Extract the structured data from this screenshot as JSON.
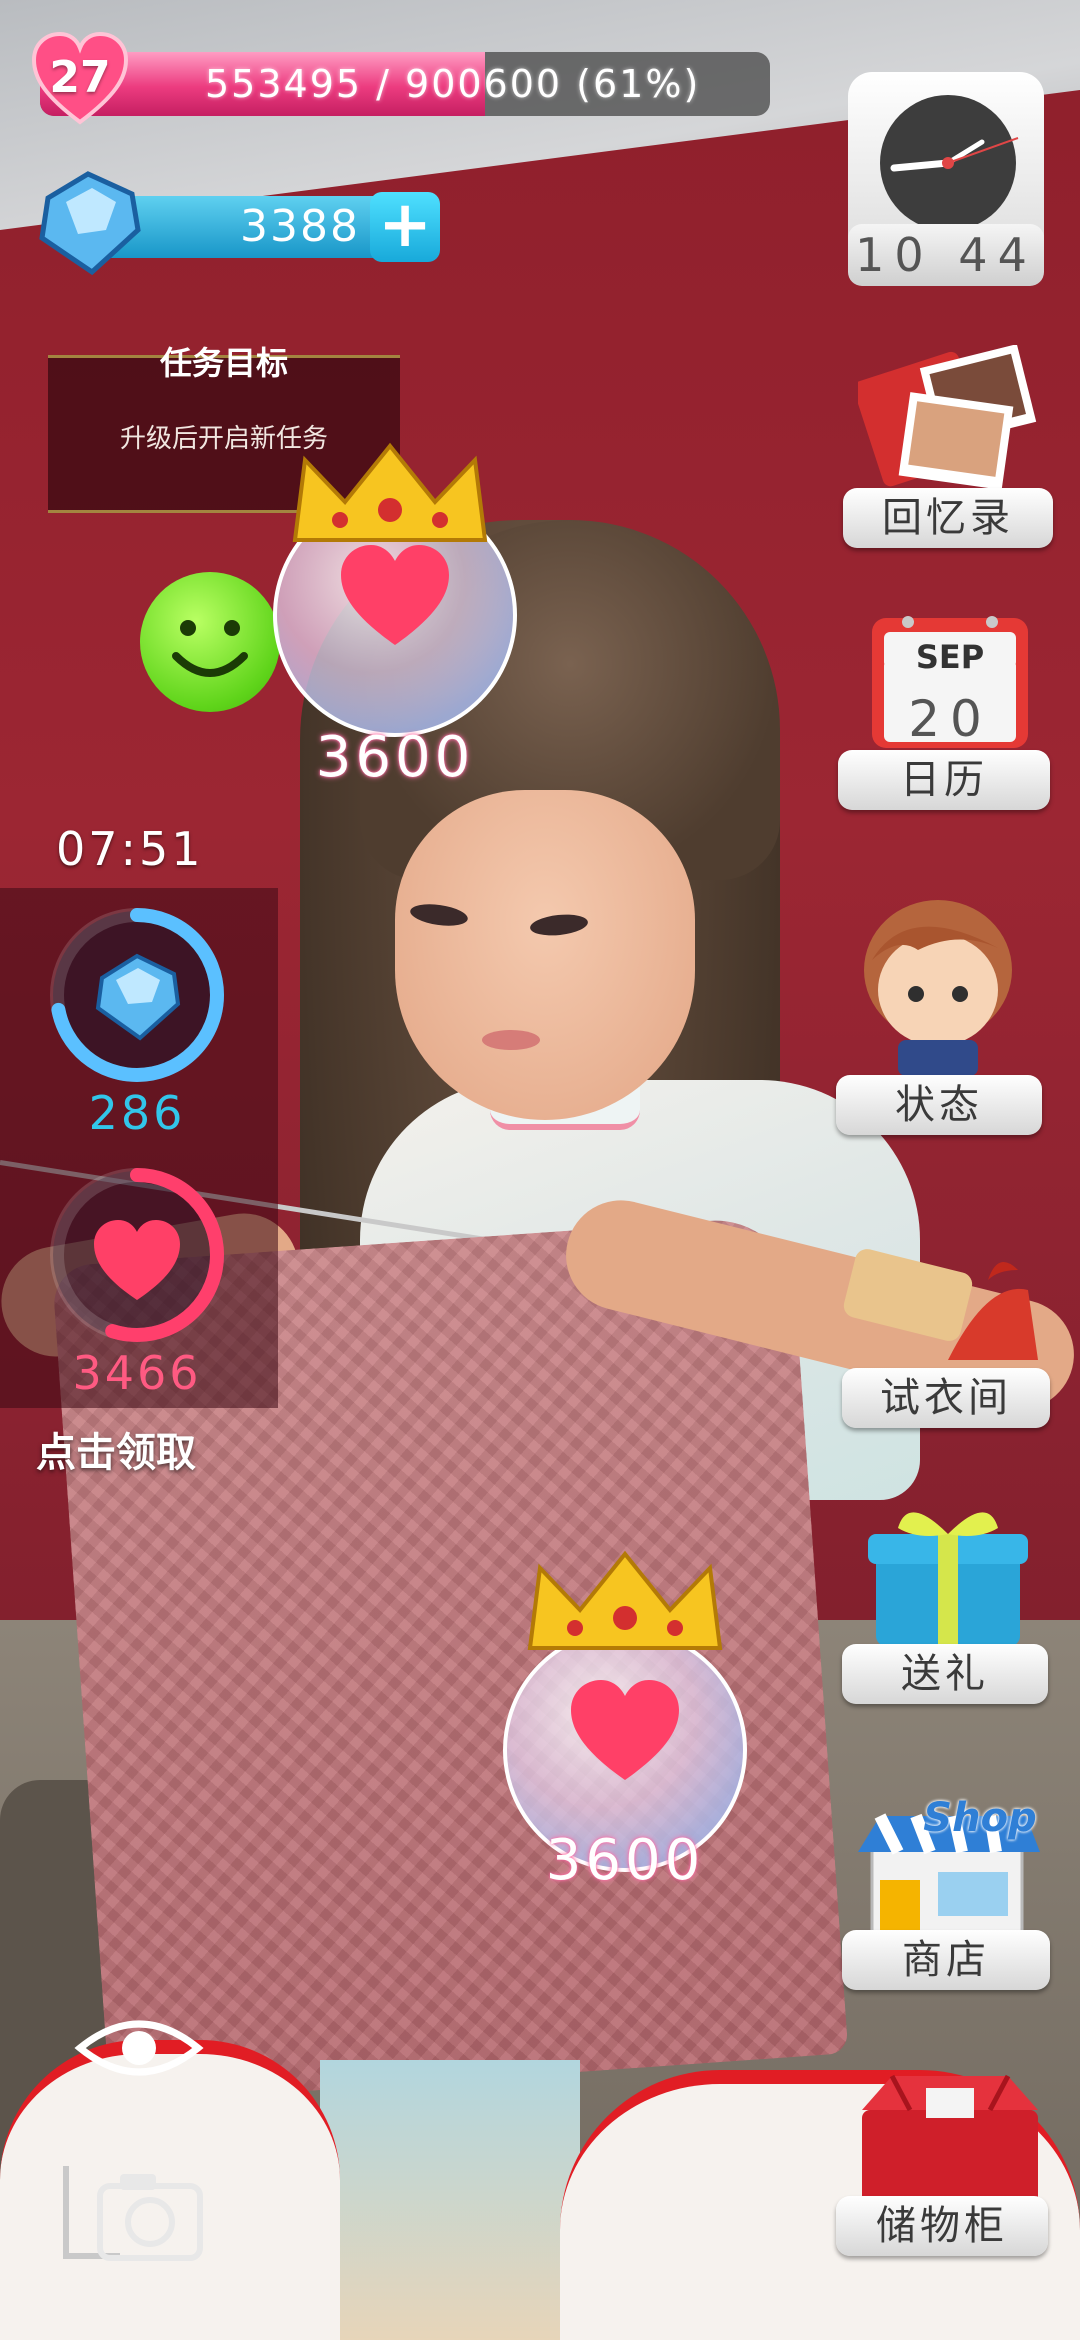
{
  "status": {
    "level": "27",
    "exp_text": "553495 / 900600 (61%)",
    "exp_progress": 0.61,
    "gems": "3388",
    "add_symbol": "+"
  },
  "quest": {
    "title": "任务目标",
    "description": "升级后开启新任务"
  },
  "bubbles": [
    {
      "value": "3600"
    },
    {
      "value": "3600"
    }
  ],
  "timer": "07:51",
  "collect": {
    "gem_amount": "286",
    "gem_progress": 0.72,
    "heart_amount": "3466",
    "heart_progress": 0.55,
    "claim_label": "点击领取"
  },
  "clock": {
    "time": "10 44"
  },
  "menu": {
    "memories": "回忆录",
    "calendar_month": "SEP",
    "calendar_day": "20",
    "calendar": "日历",
    "status": "状态",
    "fitting_room": "试衣间",
    "gift": "送礼",
    "shop": "商店",
    "shop_sign": "Shop",
    "locker": "储物柜"
  },
  "colors": {
    "exp_bar": "#ec3b7f",
    "gem_bar": "#1896c8",
    "wall": "#9c2633",
    "heart": "#ff3f6c",
    "gem_ring": "#5bc0ff"
  }
}
